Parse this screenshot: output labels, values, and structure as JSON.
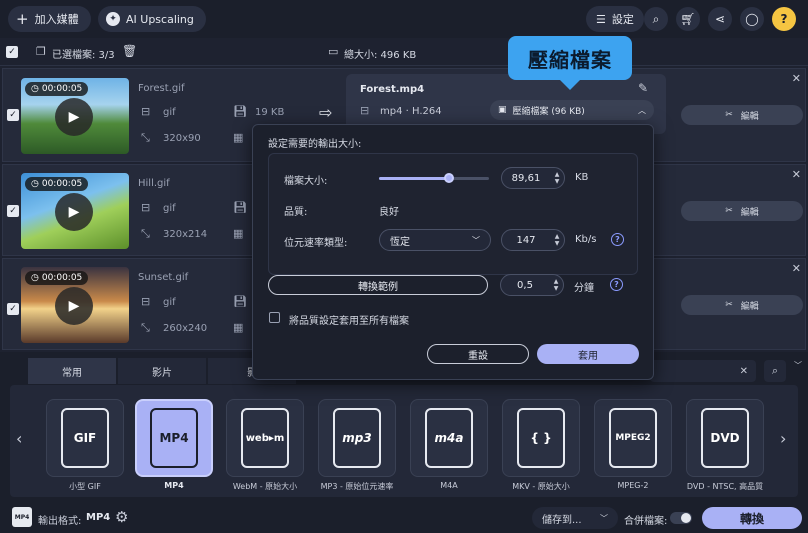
{
  "topbar": {
    "add_media": "加入媒體",
    "ai_upscaling": "AI Upscaling",
    "settings": "設定"
  },
  "toolbar": {
    "selected_label": "已選檔案: 3/3",
    "total_size": "總大小: 496 KB"
  },
  "files": [
    {
      "duration": "00:00:05",
      "name": "Forest.gif",
      "format": "gif",
      "size": "19 KB",
      "resolution": "320x90"
    },
    {
      "duration": "00:00:05",
      "name": "Hill.gif",
      "format": "gif",
      "size": "",
      "resolution": "320x214"
    },
    {
      "duration": "00:00:05",
      "name": "Sunset.gif",
      "format": "gif",
      "size": "",
      "resolution": "260x240"
    }
  ],
  "output": {
    "name": "Forest.mp4",
    "codec": "mp4 · H.264",
    "compress_label": "壓縮檔案 (96 KB)"
  },
  "edit_label": "編輯",
  "callout": "壓縮檔案",
  "popup": {
    "title": "設定需要的輸出大小:",
    "filesize_label": "檔案大小:",
    "filesize_value": "89,61",
    "filesize_unit": "KB",
    "filesize_fraction": 0.64,
    "quality_label": "品質:",
    "quality_value": "良好",
    "bitrate_type_label": "位元速率類型:",
    "bitrate_type_value": "恆定",
    "bitrate_value": "147",
    "bitrate_unit": "Kb/s",
    "sample_button": "轉換範例",
    "sample_value": "0,5",
    "sample_unit": "分鐘",
    "apply_all_label": "將品質設定套用至所有檔案",
    "reset": "重設",
    "apply": "套用"
  },
  "tabs": [
    "常用",
    "影片",
    "影"
  ],
  "formats": [
    {
      "icon": "GIF",
      "label": "小型 GIF"
    },
    {
      "icon": "MP4",
      "label": "MP4"
    },
    {
      "icon": "web▸m",
      "label": "WebM - 原始大小"
    },
    {
      "icon": "mp3",
      "label": "MP3 - 原始位元速率"
    },
    {
      "icon": "m4a",
      "label": "M4A"
    },
    {
      "icon": "{ }",
      "label": "MKV - 原始大小"
    },
    {
      "icon": "MPEG2",
      "label": "MPEG-2"
    },
    {
      "icon": "DVD",
      "label": "DVD - NTSC, 高品質"
    }
  ],
  "bottom": {
    "output_format_label": "輸出格式:",
    "output_format_value": "MP4",
    "save_to": "儲存到...",
    "merge_label": "合併檔案:",
    "convert": "轉換"
  },
  "colors": {
    "accent": "#a9b1f5",
    "callout": "#3da3f0",
    "help": "#f5c542"
  }
}
